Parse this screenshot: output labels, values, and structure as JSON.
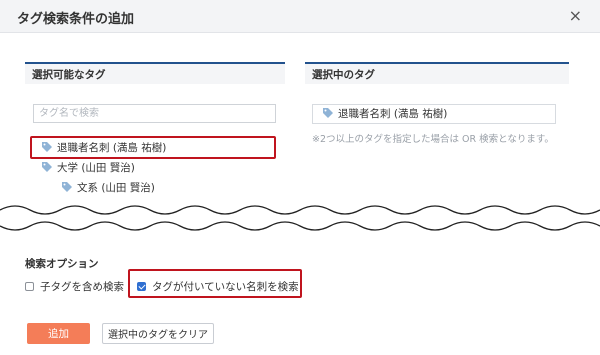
{
  "dialog": {
    "title": "タグ検索条件の追加",
    "close_label": "×"
  },
  "available": {
    "heading": "選択可能なタグ",
    "search_placeholder": "タグ名で検索",
    "tags": [
      {
        "label": "退職者名刺 (満島 祐樹)",
        "level": 0,
        "highlighted": true
      },
      {
        "label": "大学 (山田 賢治)",
        "level": 0,
        "highlighted": false
      },
      {
        "label": "文系 (山田 賢治)",
        "level": 1,
        "highlighted": false
      }
    ]
  },
  "selected": {
    "heading": "選択中のタグ",
    "tags": [
      {
        "label": "退職者名刺 (満島 祐樹)"
      }
    ],
    "note": "※2つ以上のタグを指定した場合は OR 検索となります。"
  },
  "options": {
    "heading": "検索オプション",
    "include_children": {
      "label": "子タグを含め検索",
      "checked": false
    },
    "untagged": {
      "label": "タグが付いていない名刺を検索",
      "checked": true,
      "highlighted": true
    }
  },
  "buttons": {
    "add": "追加",
    "clear": "選択中のタグをクリア"
  },
  "colors": {
    "accent_header": "#22528d",
    "add_button": "#f47d58",
    "highlight": "#c0141e",
    "checkbox": "#2f6fd1",
    "tag_icon": "#8fb3d6"
  }
}
